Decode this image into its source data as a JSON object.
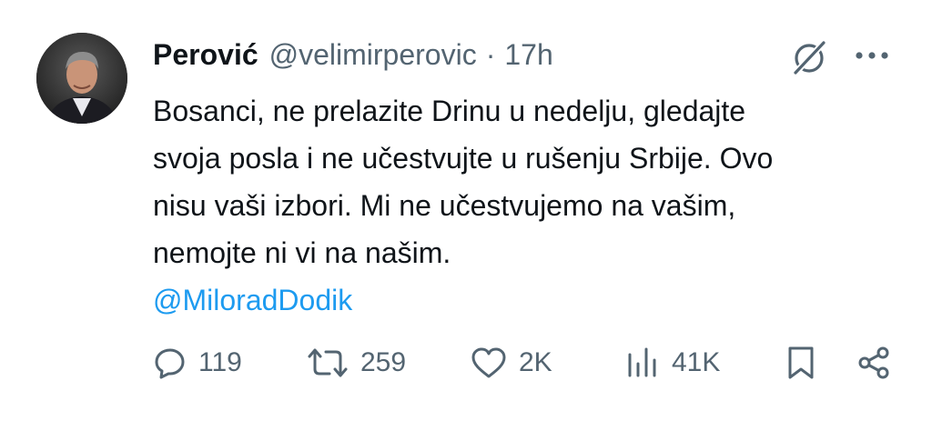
{
  "author": {
    "name": "Perović",
    "handle": "@velimirperovic",
    "separator": "·",
    "time": "17h"
  },
  "tweet": {
    "lines": [
      "Bosanci, ne prelazite Drinu u nedelju, gledajte",
      "svoja posla i ne učestvujte u rušenju Srbije. Ovo",
      "nisu vaši izbori. Mi ne učestvujemo na vašim,",
      "nemojte ni vi na našim."
    ],
    "mention": "@MiloradDodik"
  },
  "metrics": {
    "replies": "119",
    "reposts": "259",
    "likes": "2K",
    "views": "41K"
  },
  "icons": {
    "grok": "grok-icon",
    "more": "more-icon",
    "reply": "reply-icon",
    "repost": "repost-icon",
    "like": "heart-icon",
    "views": "views-icon",
    "bookmark": "bookmark-icon",
    "share": "share-icon"
  },
  "colors": {
    "text": "#0f1419",
    "secondary": "#536471",
    "accent": "#1d9bf0"
  }
}
